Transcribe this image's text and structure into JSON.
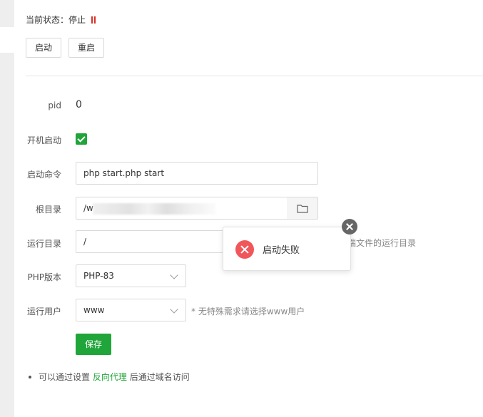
{
  "status": {
    "label": "当前状态：",
    "value": "停止",
    "color": "#d93025"
  },
  "actions": {
    "start": "启动",
    "restart": "重启"
  },
  "form": {
    "pid": {
      "label": "pid",
      "value": "0"
    },
    "autostart": {
      "label": "开机启动",
      "checked": true
    },
    "command": {
      "label": "启动命令",
      "value": "php start.php start"
    },
    "root_dir": {
      "label": "根目录",
      "value": "/w"
    },
    "run_dir": {
      "label": "运行目录",
      "value": "/",
      "hint": "端文件的运行目录"
    },
    "php_version": {
      "label": "PHP版本",
      "value": "PHP-83"
    },
    "run_user": {
      "label": "运行用户",
      "value": "www",
      "hint": "* 无特殊需求请选择www用户"
    },
    "save": "保存"
  },
  "note": {
    "prefix": "可以通过设置",
    "link": "反向代理",
    "suffix": "后通过域名访问"
  },
  "toast": {
    "message": "启动失败"
  },
  "colors": {
    "accent": "#20a53a",
    "error": "#f0575b"
  }
}
